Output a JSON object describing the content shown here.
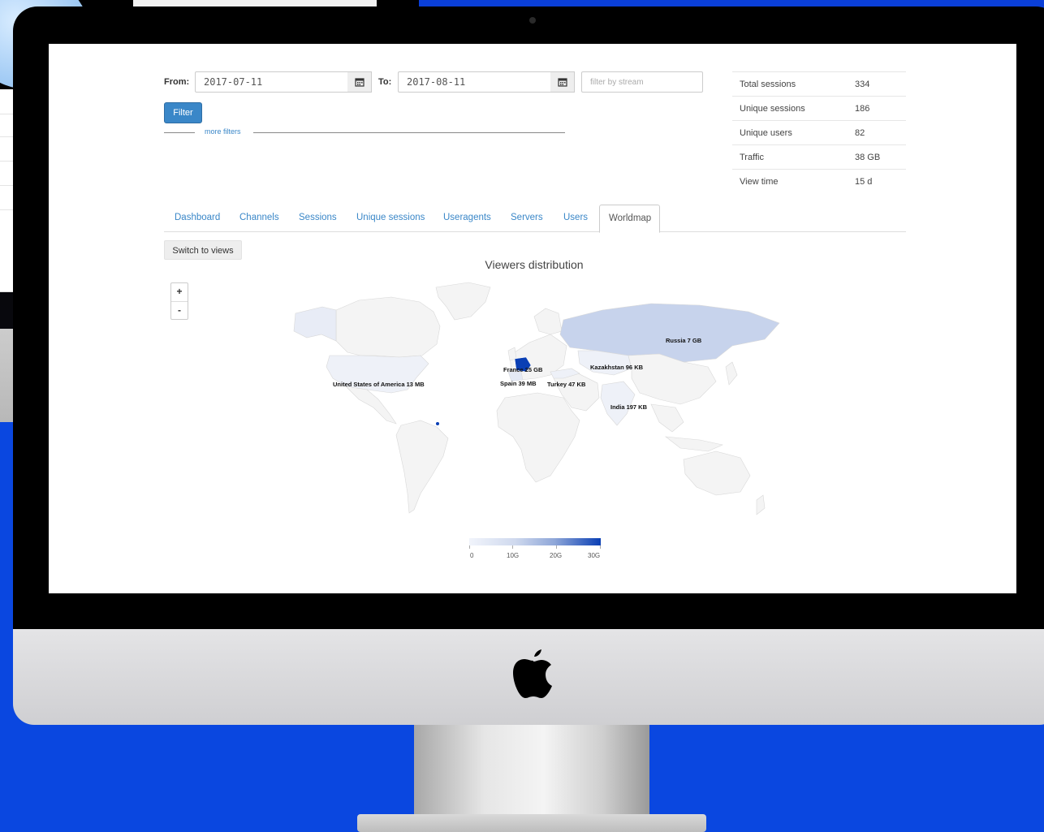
{
  "filters": {
    "from_label": "From:",
    "from_value": "2017-07-11",
    "to_label": "To:",
    "to_value": "2017-08-11",
    "stream_placeholder": "filter by stream",
    "filter_button": "Filter",
    "more_filters": "more filters"
  },
  "stats": [
    {
      "label": "Total sessions",
      "value": "334"
    },
    {
      "label": "Unique sessions",
      "value": "186"
    },
    {
      "label": "Unique users",
      "value": "82"
    },
    {
      "label": "Traffic",
      "value": "38 GB"
    },
    {
      "label": "View time",
      "value": "15 d"
    }
  ],
  "tabs": [
    {
      "label": "Dashboard",
      "active": false
    },
    {
      "label": "Channels",
      "active": false
    },
    {
      "label": "Sessions",
      "active": false
    },
    {
      "label": "Unique sessions",
      "active": false
    },
    {
      "label": "Useragents",
      "active": false
    },
    {
      "label": "Servers",
      "active": false
    },
    {
      "label": "Users",
      "active": false
    },
    {
      "label": "Worldmap",
      "active": true
    }
  ],
  "switch_button": "Switch to views",
  "map": {
    "title": "Viewers distribution",
    "zoom_in": "+",
    "zoom_out": "-",
    "country_labels": [
      {
        "text": "Russia 7 GB"
      },
      {
        "text": "France 25 GB"
      },
      {
        "text": "Kazakhstan 96 KB"
      },
      {
        "text": "United States of America 13 MB"
      },
      {
        "text": "Spain 39 MB"
      },
      {
        "text": "Turkey 47 KB"
      },
      {
        "text": "India 197 KB"
      }
    ],
    "legend_ticks": [
      "0",
      "10G",
      "20G",
      "30G"
    ],
    "colors": {
      "low": "#f1f4fb",
      "mid": "#8ea6d8",
      "high": "#0a3fb4"
    }
  }
}
